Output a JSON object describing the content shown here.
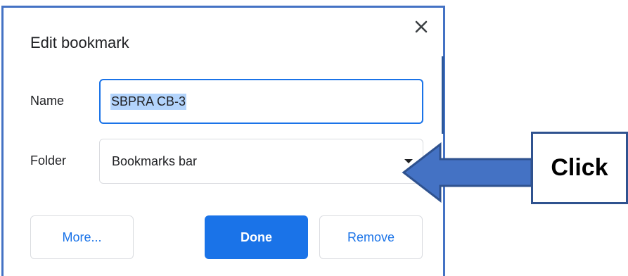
{
  "dialog": {
    "title": "Edit bookmark",
    "name_label": "Name",
    "name_value": "SBPRA CB-3",
    "folder_label": "Folder",
    "folder_value": "Bookmarks bar",
    "buttons": {
      "more": "More...",
      "done": "Done",
      "remove": "Remove"
    }
  },
  "annotation": {
    "text": "Click"
  },
  "colors": {
    "accent": "#1a73e8",
    "frame": "#4472c4",
    "arrow": "#4472c4"
  },
  "icons": {
    "close": "close-icon",
    "dropdown": "chevron-down-icon"
  }
}
